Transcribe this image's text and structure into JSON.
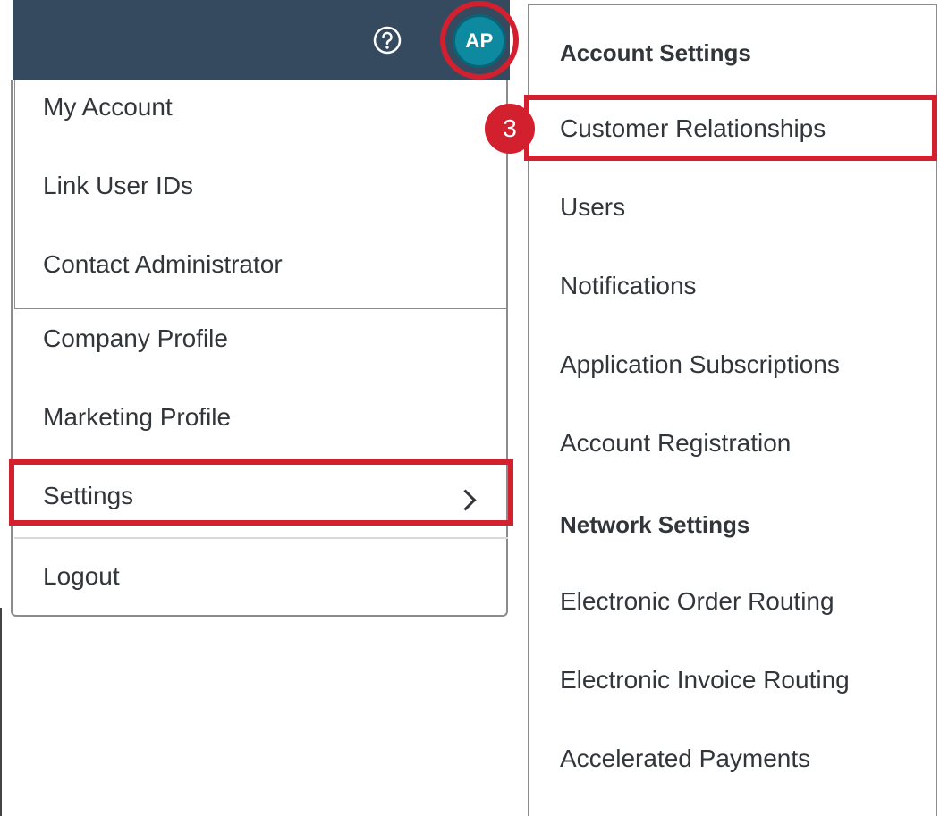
{
  "shell": {
    "help_icon": "question-circle-icon",
    "avatar_initials": "AP"
  },
  "user_menu": {
    "items": [
      {
        "label": "My Account"
      },
      {
        "label": "Link User IDs"
      },
      {
        "label": "Contact Administrator"
      },
      {
        "label": "Company Profile"
      },
      {
        "label": "Marketing Profile"
      },
      {
        "label": "Settings",
        "icon": "chevron-right-icon"
      },
      {
        "label": "Logout"
      }
    ]
  },
  "settings_panel": {
    "sections": [
      {
        "title": "Account Settings",
        "items": [
          {
            "label": "Customer Relationships"
          },
          {
            "label": "Users"
          },
          {
            "label": "Notifications"
          },
          {
            "label": "Application Subscriptions"
          },
          {
            "label": "Account Registration"
          }
        ]
      },
      {
        "title": "Network Settings",
        "items": [
          {
            "label": "Electronic Order Routing"
          },
          {
            "label": "Electronic Invoice Routing"
          },
          {
            "label": "Accelerated Payments"
          }
        ]
      }
    ]
  },
  "annotations": {
    "step_number": "3",
    "highlight_color": "#d2202f"
  },
  "colors": {
    "shell_bar": "#354a5f",
    "avatar_bg": "#0d8a9f",
    "text": "#32363a"
  }
}
